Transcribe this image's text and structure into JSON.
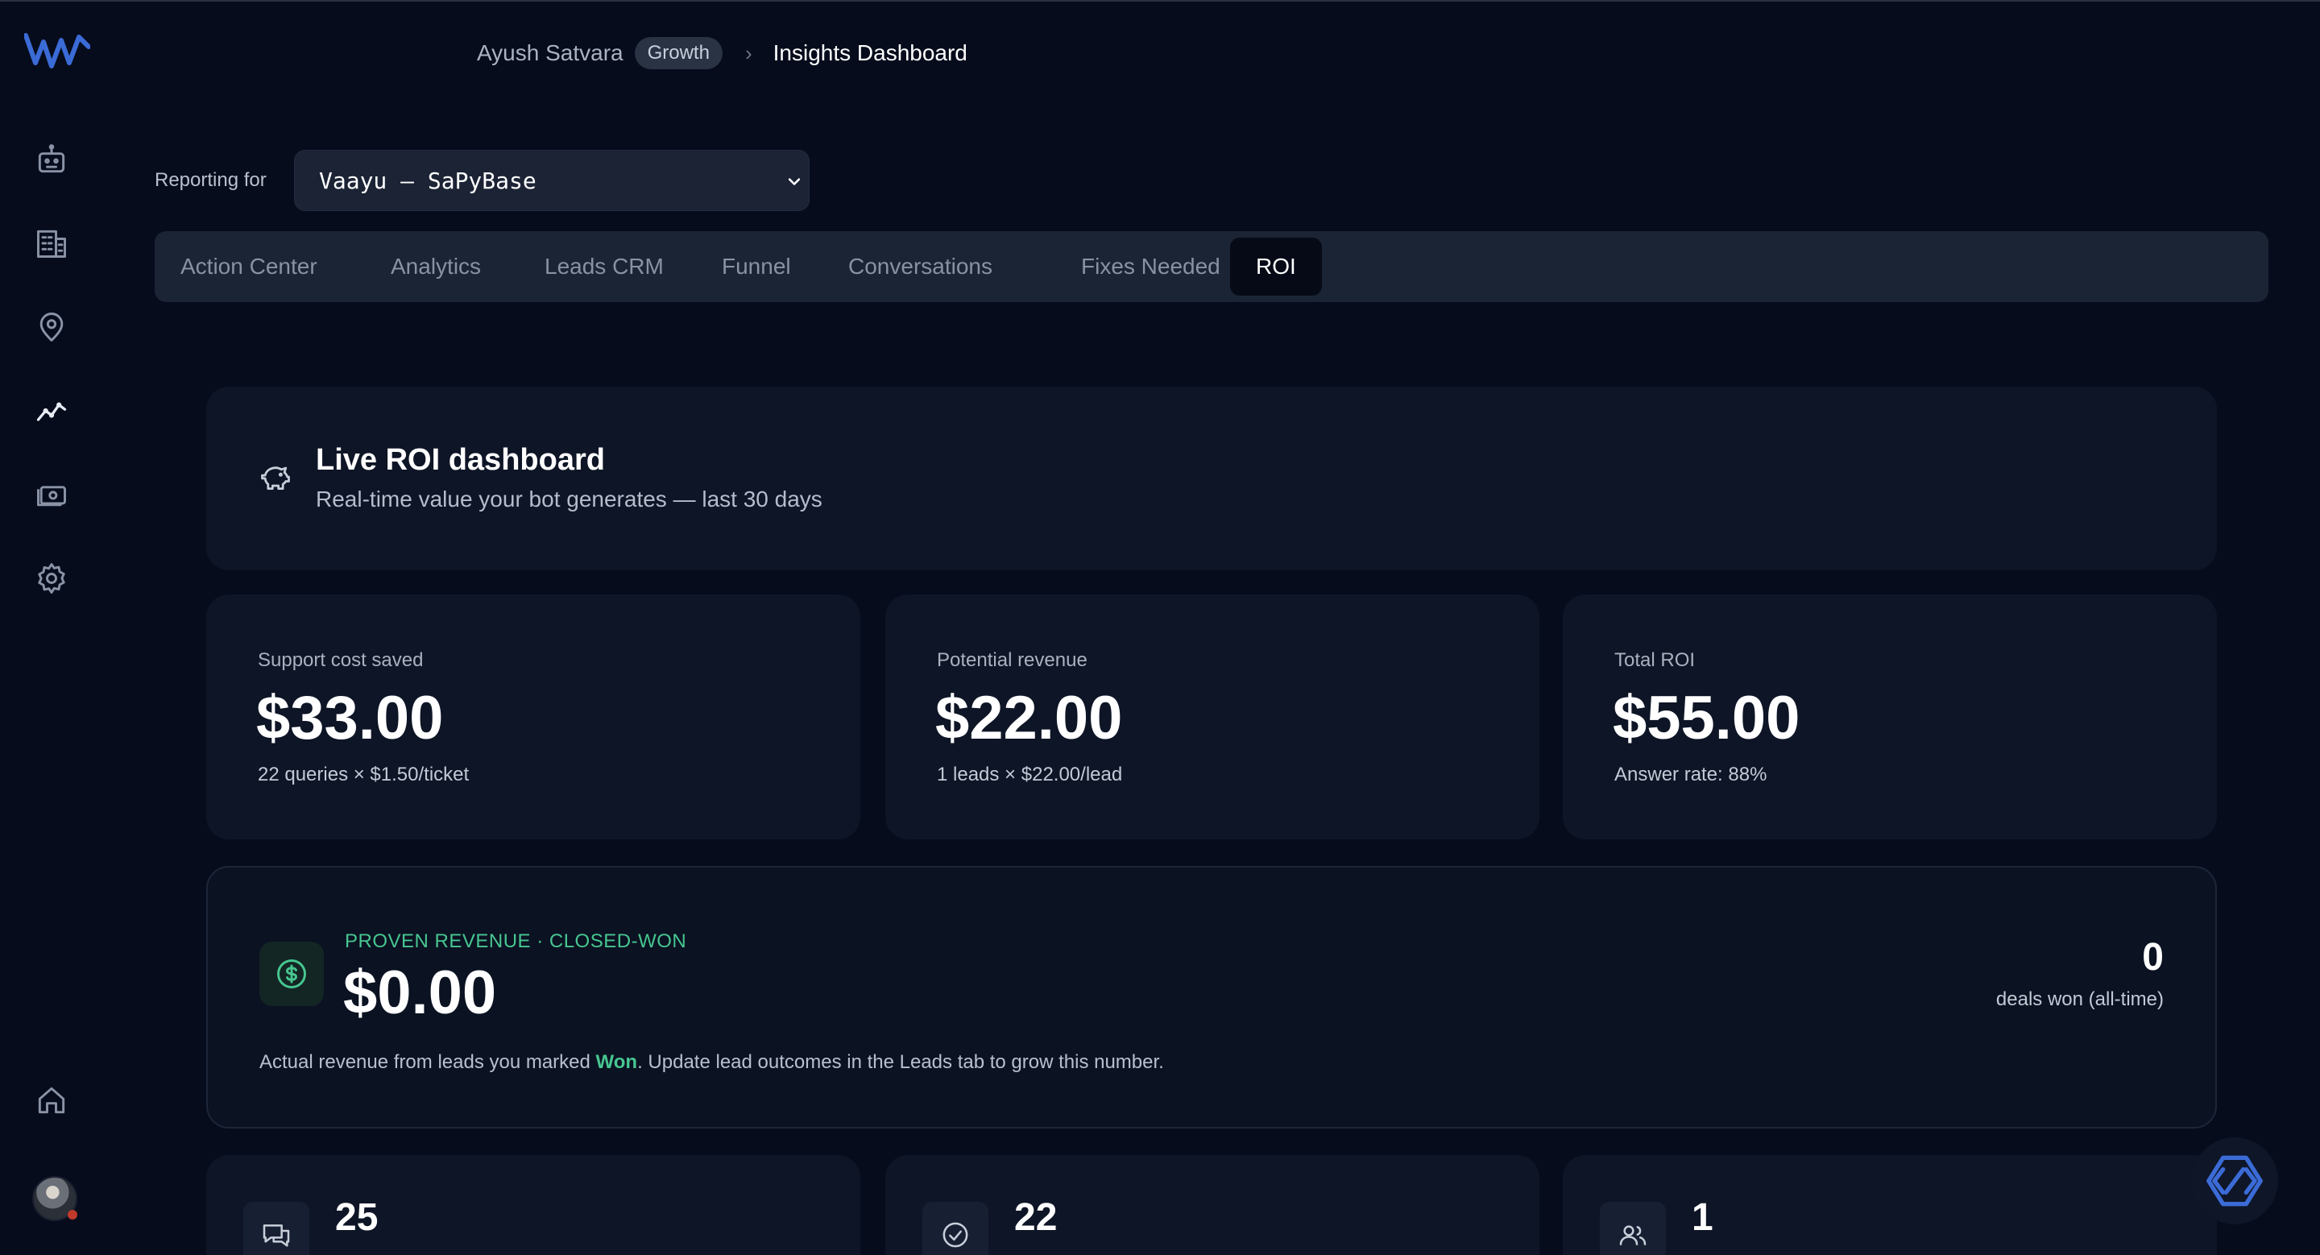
{
  "breadcrumb": {
    "user": "Ayush Satvara",
    "plan_badge": "Growth",
    "page": "Insights Dashboard"
  },
  "sidebar": {
    "icons": [
      "logo-icon",
      "bot-icon",
      "building-icon",
      "location-icon",
      "analytics-icon",
      "money-icon",
      "settings-icon",
      "home-icon",
      "avatar"
    ]
  },
  "reporting": {
    "label": "Reporting for",
    "selected": "Vaayu — SaPyBase"
  },
  "tabs": [
    {
      "label": "Action Center"
    },
    {
      "label": "Analytics"
    },
    {
      "label": "Leads CRM"
    },
    {
      "label": "Funnel"
    },
    {
      "label": "Conversations"
    },
    {
      "label": "Fixes Needed"
    },
    {
      "label": "ROI",
      "active": true
    }
  ],
  "hero": {
    "title": "Live ROI dashboard",
    "subtitle": "Real-time value your bot generates — last 30 days"
  },
  "stats": [
    {
      "label": "Support cost saved",
      "value": "$33.00",
      "note": "22 queries × $1.50/ticket"
    },
    {
      "label": "Potential revenue",
      "value": "$22.00",
      "note": "1 leads × $22.00/lead"
    },
    {
      "label": "Total ROI",
      "value": "$55.00",
      "note": "Answer rate: 88%"
    }
  ],
  "proven": {
    "kicker": "PROVEN REVENUE · CLOSED-WON",
    "value": "$0.00",
    "desc_pre": "Actual revenue from leads you marked ",
    "desc_won": "Won",
    "desc_post": ". Update lead outcomes in the Leads tab to grow this number.",
    "deals_count": "0",
    "deals_label": "deals won (all-time)"
  },
  "mini": [
    {
      "value": "25",
      "icon": "chat-icon"
    },
    {
      "value": "22",
      "icon": "check-icon"
    },
    {
      "value": "1",
      "icon": "users-icon"
    }
  ],
  "colors": {
    "background": "#060c1c",
    "card": "#0e1526",
    "accent_green": "#47c690",
    "active_tab": "#060a16"
  }
}
